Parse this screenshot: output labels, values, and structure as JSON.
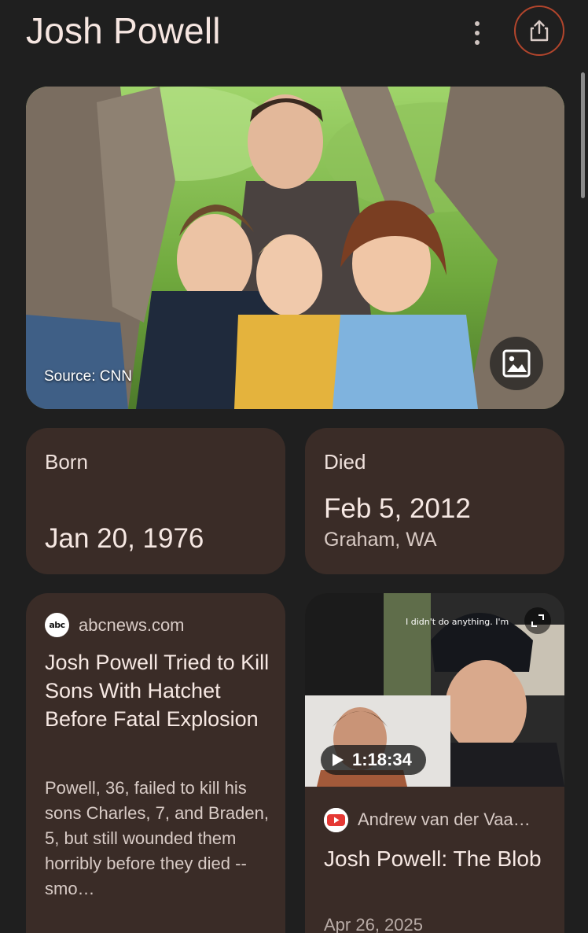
{
  "header": {
    "title": "Josh Powell",
    "menu_icon": "more-vert-icon",
    "share_icon": "share-icon",
    "accent": "#b2452c"
  },
  "hero": {
    "source": "Source: CNN",
    "image_button_icon": "image-icon"
  },
  "born": {
    "label": "Born",
    "date": "Jan 20, 1976"
  },
  "died": {
    "label": "Died",
    "date": "Feb 5, 2012",
    "place": "Graham, WA"
  },
  "news": {
    "logo_text": "abc",
    "source": "abcnews.com",
    "title": "Josh Powell Tried to Kill Sons With Hatchet Before Fatal Explosion",
    "snippet": "Powell, 36, failed to kill his sons Charles, 7, and Braden, 5, but still wounded them horribly before they died -- smo…"
  },
  "video": {
    "caption_overlay": "I didn't do anything. I'm",
    "duration": "1:18:34",
    "channel": "Andrew van der Vaa…",
    "title": "Josh Powell: The Blob",
    "date": "Apr 26, 2025",
    "expand_icon": "expand-icon",
    "play_icon": "play-icon",
    "channel_icon": "youtube-icon"
  },
  "colors": {
    "background": "#1f1f1f",
    "card": "#3a2c27",
    "text": "#f6e8e3"
  }
}
